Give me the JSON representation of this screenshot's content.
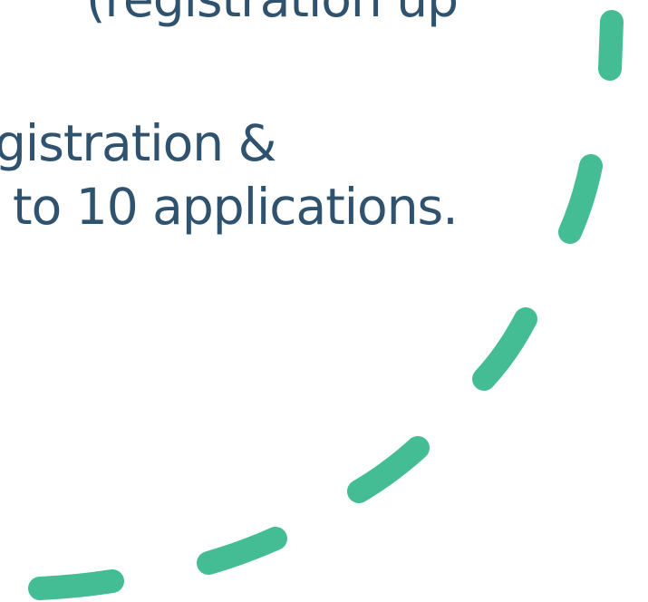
{
  "text": {
    "line_top": "(registration up",
    "line_1": "gistration &",
    "line_2": "to 10 applications."
  },
  "colors": {
    "text": "#2f536e",
    "accent": "#45bd94"
  }
}
